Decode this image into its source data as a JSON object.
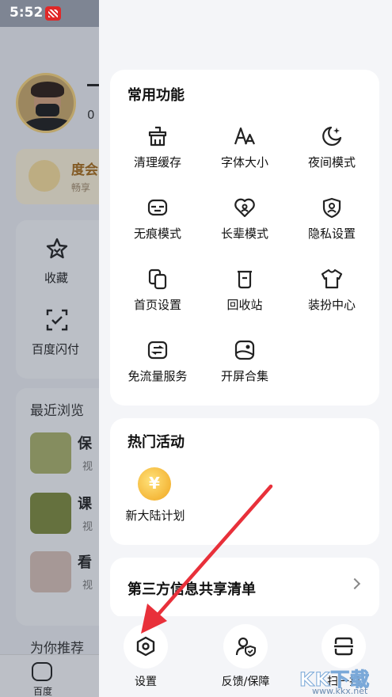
{
  "status_bar": {
    "time": "5:52"
  },
  "background": {
    "vip_title": "度会",
    "vip_sub": "畅享",
    "zero": "0",
    "fav_label": "收藏",
    "pay_label": "百度闪付",
    "recent_title": "最近浏览",
    "recent_items": [
      {
        "title": "保",
        "sub": "视"
      },
      {
        "title": "课",
        "sub": "视"
      },
      {
        "title": "看",
        "sub": "视"
      }
    ],
    "recommend": "为你推荐",
    "home_label": "百度"
  },
  "drawer": {
    "common": {
      "title": "常用功能",
      "items": [
        {
          "label": "清理缓存",
          "icon": "clean-icon"
        },
        {
          "label": "字体大小",
          "icon": "font-size-icon"
        },
        {
          "label": "夜间模式",
          "icon": "moon-icon"
        },
        {
          "label": "无痕模式",
          "icon": "incognito-icon"
        },
        {
          "label": "长辈模式",
          "icon": "heart-icon"
        },
        {
          "label": "隐私设置",
          "icon": "shield-user-icon"
        },
        {
          "label": "首页设置",
          "icon": "homepage-icon"
        },
        {
          "label": "回收站",
          "icon": "trash-icon"
        },
        {
          "label": "装扮中心",
          "icon": "shirt-icon"
        },
        {
          "label": "免流量服务",
          "icon": "data-card-icon"
        },
        {
          "label": "开屏合集",
          "icon": "splash-icon"
        }
      ]
    },
    "hot": {
      "title": "热门活动",
      "item_label": "新大陆计划"
    },
    "third_party": {
      "label": "第三方信息共享清单"
    },
    "bottom": {
      "settings": "设置",
      "feedback": "反馈/保障",
      "scan": "扫一扫"
    }
  },
  "watermark": {
    "text": "KK下载",
    "url": "www.kkx.net"
  },
  "colors": {
    "accent_red": "#e02828",
    "vip_gold": "#a76b1a"
  }
}
